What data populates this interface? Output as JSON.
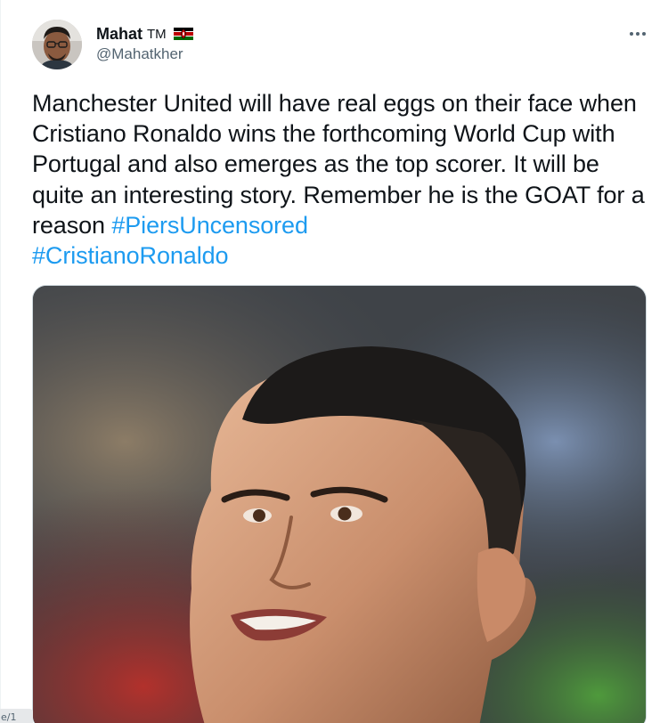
{
  "author": {
    "name": "Mahat",
    "trademark": "TM",
    "handle": "@Mahatkher",
    "flag_icon": "kenya-flag-icon"
  },
  "menu_icon": "more-horizontal-icon",
  "tweet": {
    "text_before": "Manchester United will have real eggs on their face when Cristiano Ronaldo wins the forthcoming World Cup with Portugal and also emerges as the top scorer. It will be quite an interesting story. Remember he is the GOAT for a reason ",
    "hashtag_1": "#PiersUncensored",
    "hashtag_2": "#CristianoRonaldo"
  },
  "corner_chip_text": "e/1",
  "colors": {
    "link": "#1d9bf0",
    "secondary_text": "#536471",
    "primary_text": "#0f1419"
  }
}
